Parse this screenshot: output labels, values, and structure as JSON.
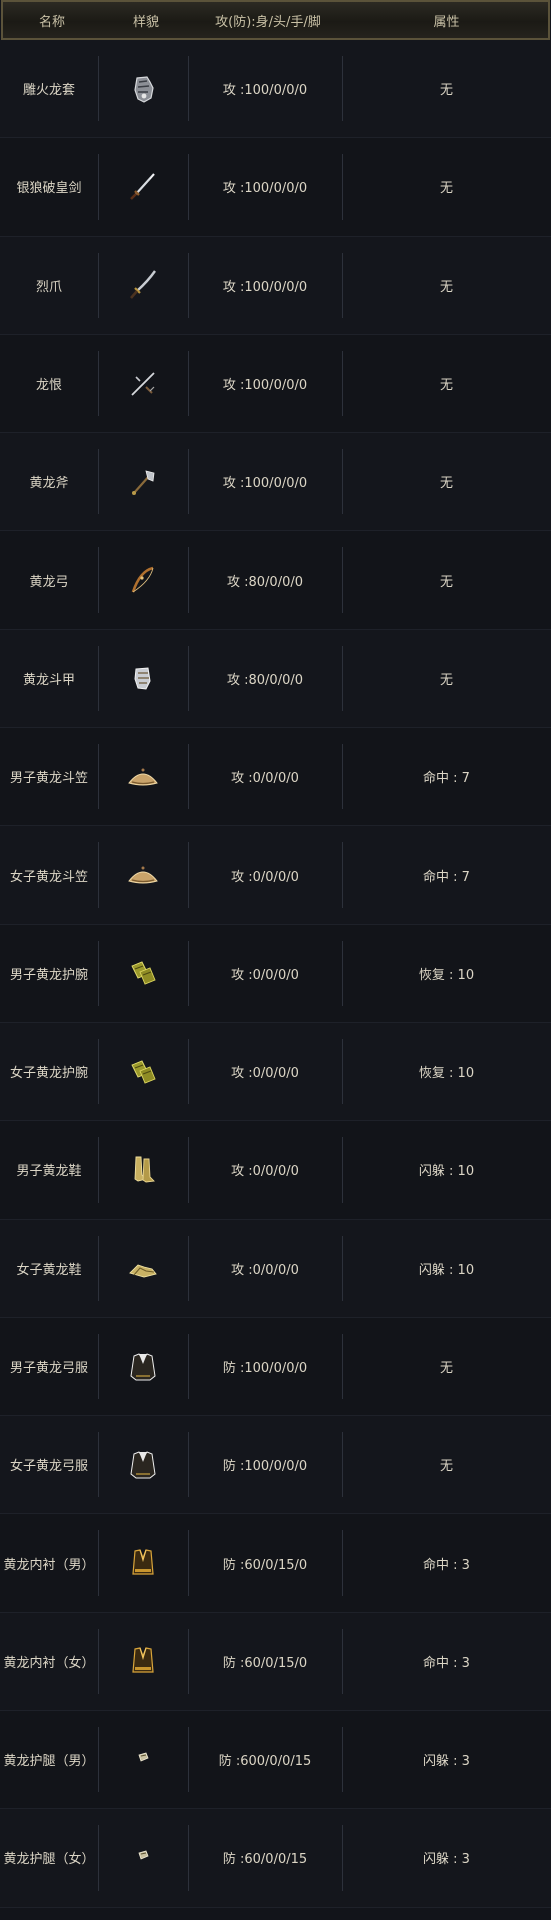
{
  "header": {
    "name": "名称",
    "look": "样貌",
    "stat": "攻(防):身/头/手/脚",
    "attr": "属性"
  },
  "rows": [
    {
      "name": "雕火龙套",
      "icon": "gauntlet-icon",
      "stat": "攻 :100/0/0/0",
      "attr": "无"
    },
    {
      "name": "银狼破皇剑",
      "icon": "sword-icon",
      "stat": "攻 :100/0/0/0",
      "attr": "无"
    },
    {
      "name": "烈爪",
      "icon": "blade-icon",
      "stat": "攻 :100/0/0/0",
      "attr": "无"
    },
    {
      "name": "龙恨",
      "icon": "crossed-swords-icon",
      "stat": "攻 :100/0/0/0",
      "attr": "无"
    },
    {
      "name": "黄龙斧",
      "icon": "axe-icon",
      "stat": "攻 :100/0/0/0",
      "attr": "无"
    },
    {
      "name": "黄龙弓",
      "icon": "bow-icon",
      "stat": "攻 :80/0/0/0",
      "attr": "无"
    },
    {
      "name": "黄龙斗甲",
      "icon": "claw-gauntlet-icon",
      "stat": "攻 :80/0/0/0",
      "attr": "无"
    },
    {
      "name": "男子黄龙斗笠",
      "icon": "straw-hat-icon",
      "stat": "攻 :0/0/0/0",
      "attr": "命中 : 7"
    },
    {
      "name": "女子黄龙斗笠",
      "icon": "straw-hat-icon",
      "stat": "攻 :0/0/0/0",
      "attr": "命中 : 7"
    },
    {
      "name": "男子黄龙护腕",
      "icon": "bracer-icon",
      "stat": "攻 :0/0/0/0",
      "attr": "恢复 : 10"
    },
    {
      "name": "女子黄龙护腕",
      "icon": "bracer-icon",
      "stat": "攻 :0/0/0/0",
      "attr": "恢复 : 10"
    },
    {
      "name": "男子黄龙鞋",
      "icon": "boots-icon",
      "stat": "攻 :0/0/0/0",
      "attr": "闪躲 : 10"
    },
    {
      "name": "女子黄龙鞋",
      "icon": "shoes-icon",
      "stat": "攻 :0/0/0/0",
      "attr": "闪躲 : 10"
    },
    {
      "name": "男子黄龙弓服",
      "icon": "robe-icon",
      "stat": "防 :100/0/0/0",
      "attr": "无"
    },
    {
      "name": "女子黄龙弓服",
      "icon": "robe-icon",
      "stat": "防 :100/0/0/0",
      "attr": "无"
    },
    {
      "name": "黄龙内衬（男）",
      "icon": "inner-vest-icon",
      "stat": "防 :60/0/15/0",
      "attr": "命中 : 3"
    },
    {
      "name": "黄龙内衬（女）",
      "icon": "inner-vest-icon",
      "stat": "防 :60/0/15/0",
      "attr": "命中 : 3"
    },
    {
      "name": "黄龙护腿（男）",
      "icon": "leg-guard-icon",
      "stat": "防 :600/0/0/15",
      "attr": "闪躲 : 3"
    },
    {
      "name": "黄龙护腿（女）",
      "icon": "leg-guard-icon",
      "stat": "防 :60/0/0/15",
      "attr": "闪躲 : 3"
    }
  ]
}
